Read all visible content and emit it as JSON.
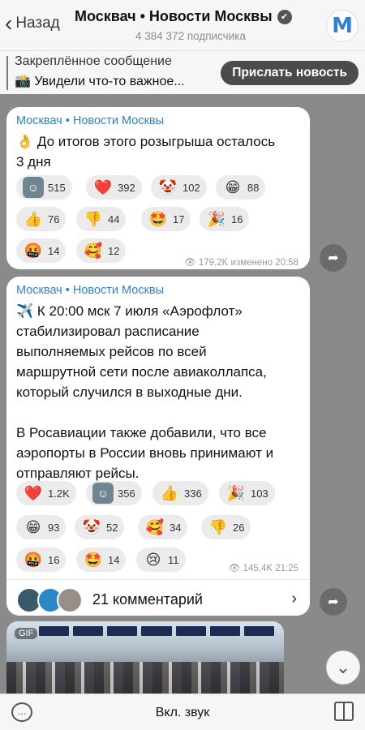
{
  "header": {
    "back_label": "Назад",
    "title": "Москвач • Новости Москвы",
    "subscribers": "4 384 372 подписчика",
    "avatar_letter": "M"
  },
  "pinned": {
    "title": "Закреплённое сообщение",
    "text": "📸 Увидели что-то важное...",
    "button": "Прислать новость"
  },
  "messages": [
    {
      "sender": "Москвач • Новости Москвы",
      "text": "👌 До итогов этого розыгрыша осталось\n3 дня",
      "reactions": [
        {
          "emoji": "🙂",
          "count": "515"
        },
        {
          "emoji": "❤️",
          "count": "392"
        },
        {
          "emoji": "🤡",
          "count": "102"
        },
        {
          "emoji": "😁",
          "count": "88"
        },
        {
          "emoji": "👍",
          "count": "76"
        },
        {
          "emoji": "👎",
          "count": "44"
        },
        {
          "emoji": "🤩",
          "count": "17"
        },
        {
          "emoji": "🎉",
          "count": "16"
        },
        {
          "emoji": "🤬",
          "count": "14"
        },
        {
          "emoji": "🥰",
          "count": "12"
        }
      ],
      "meta": "👁 179,2K изменено 20:58"
    },
    {
      "sender": "Москвач • Новости Москвы",
      "text": "✈️ К 20:00 мск 7 июля «Аэрофлот»\nстабилизировал расписание\nвыполняемых рейсов по всей\nмаршрутной сети после авиаколлапса,\nкоторый случился в выходные дни.\n\nВ Росавиации также добавили, что все\nаэропорты в России вновь принимают и\nотправляют рейсы.",
      "reactions": [
        {
          "emoji": "❤️",
          "count": "1.2K"
        },
        {
          "emoji": "🙂",
          "count": "356"
        },
        {
          "emoji": "👍",
          "count": "336"
        },
        {
          "emoji": "🎉",
          "count": "103"
        },
        {
          "emoji": "😁",
          "count": "93"
        },
        {
          "emoji": "🤡",
          "count": "52"
        },
        {
          "emoji": "🥰",
          "count": "34"
        },
        {
          "emoji": "👎",
          "count": "26"
        },
        {
          "emoji": "🤬",
          "count": "16"
        },
        {
          "emoji": "🤩",
          "count": "14"
        },
        {
          "emoji": "😢",
          "count": "11"
        }
      ],
      "meta": "👁 145,4K 21:25",
      "comments": "21 комментарий"
    }
  ],
  "media": {
    "badge": "GIF"
  },
  "bottom": {
    "center": "Вкл. звук"
  }
}
